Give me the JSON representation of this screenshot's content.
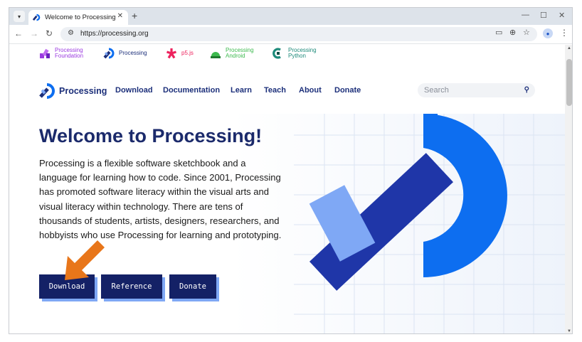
{
  "browser": {
    "tab_title": "Welcome to Processing! / Pr",
    "url": "https://processing.org"
  },
  "foundation_bar": {
    "items": [
      {
        "line1": "Processing",
        "line2": "Foundation",
        "color": "#9b3ae0"
      },
      {
        "line1": "Processing",
        "line2": "",
        "color": "#1c2f7a"
      },
      {
        "line1": "p5.js",
        "line2": "",
        "color": "#ed225d"
      },
      {
        "line1": "Processing",
        "line2": "Android",
        "color": "#3dba4e"
      },
      {
        "line1": "Processing",
        "line2": "Python",
        "color": "#1d8a7a"
      }
    ]
  },
  "nav": {
    "logo_text": "Processing",
    "links": [
      "Download",
      "Documentation",
      "Learn",
      "Teach",
      "About",
      "Donate"
    ],
    "search_placeholder": "Search"
  },
  "hero": {
    "title": "Welcome to Processing!",
    "body": "Processing is a flexible software sketchbook and a language for learning how to code. Since 2001, Processing has promoted software literacy within the visual arts and visual literacy within technology. There are tens of thousands of students, artists, designers, researchers, and hobbyists who use Processing for learning and prototyping.",
    "buttons": [
      "Download",
      "Reference",
      "Donate"
    ]
  },
  "colors": {
    "navy": "#142166",
    "blue": "#0d6ef0",
    "light_blue": "#7fa8f5",
    "arrow": "#e8761a"
  }
}
